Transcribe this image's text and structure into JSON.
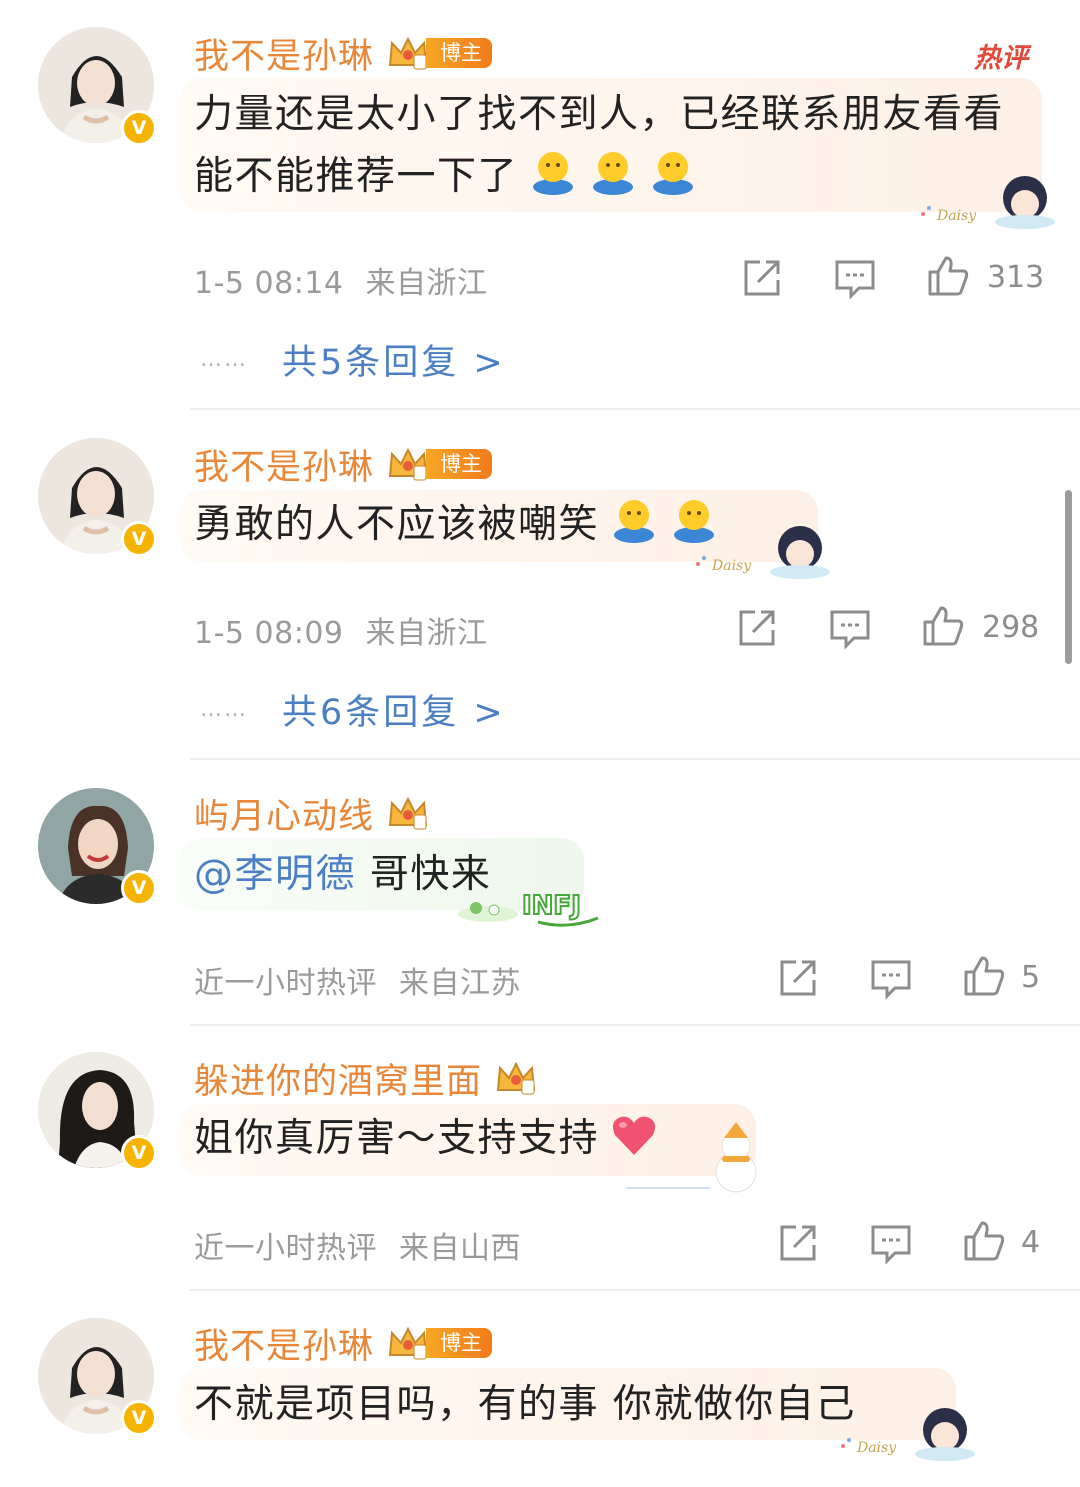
{
  "hot_label": "热评",
  "badge_blogger": "博主",
  "comments": [
    {
      "username": "我不是孙琳",
      "is_blogger": true,
      "verified": "V",
      "text": "力量还是太小了找不到人，已经联系朋友看看能不能推荐一下了",
      "emojis": [
        "hug-emoji",
        "hug-emoji",
        "hug-emoji"
      ],
      "time": "1-5 08:14",
      "location": "来自浙江",
      "likes": "313",
      "replies": "共5条回复 >"
    },
    {
      "username": "我不是孙琳",
      "is_blogger": true,
      "verified": "V",
      "text": "勇敢的人不应该被嘲笑",
      "emojis": [
        "hug-emoji",
        "hug-emoji"
      ],
      "time": "1-5 08:09",
      "location": "来自浙江",
      "likes": "298",
      "replies": "共6条回复 >"
    },
    {
      "username": "屿月心动线",
      "is_blogger": false,
      "verified": "V",
      "mention": "@李明德",
      "text": " 哥快来",
      "bubble_sticker": "INFJ",
      "time": "近一小时热评",
      "location": "来自江苏",
      "likes": "5"
    },
    {
      "username": "躲进你的酒窝里面",
      "is_blogger": false,
      "verified": "V",
      "text": "姐你真厉害～支持支持",
      "emojis": [
        "heart-emoji"
      ],
      "time": "近一小时热评",
      "location": "来自山西",
      "likes": "4"
    },
    {
      "username": "我不是孙琳",
      "is_blogger": true,
      "verified": "V",
      "text": "不就是项目吗，有的事 你就做你自己"
    }
  ],
  "colors": {
    "username": "#e8873a",
    "link": "#4a7fc4",
    "meta": "#9a9a9a",
    "verified": "#f6b400",
    "hot": "#e14a3a"
  }
}
